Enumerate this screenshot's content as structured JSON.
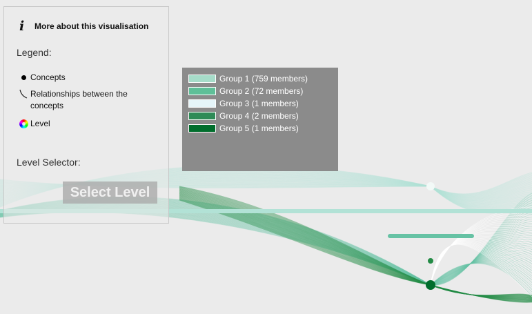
{
  "info_panel": {
    "about_icon": "info-icon",
    "about_label": "More about this visualisation",
    "legend_title": "Legend:",
    "legend_items": [
      {
        "icon": "dot-icon",
        "label": "Concepts"
      },
      {
        "icon": "curve-icon",
        "label": "Relationships between the concepts"
      },
      {
        "icon": "color-wheel-icon",
        "label": "Level"
      }
    ],
    "level_selector_title": "Level Selector:",
    "select_level_label": "Select Level"
  },
  "groups": [
    {
      "label": "Group 1 (759 members)",
      "color": "#a6dcc9"
    },
    {
      "label": "Group 2 (72 members)",
      "color": "#5fbf98"
    },
    {
      "label": "Group 3 (1 members)",
      "color": "#e5f5f9"
    },
    {
      "label": "Group 4 (2 members)",
      "color": "#2e8b57"
    },
    {
      "label": "Group 5 (1 members)",
      "color": "#006d2c"
    }
  ],
  "colors": {
    "background": "#ebebeb",
    "edge_light": "#b2e2d6",
    "edge_mid": "#66c2a4",
    "edge_dark": "#238b45"
  }
}
